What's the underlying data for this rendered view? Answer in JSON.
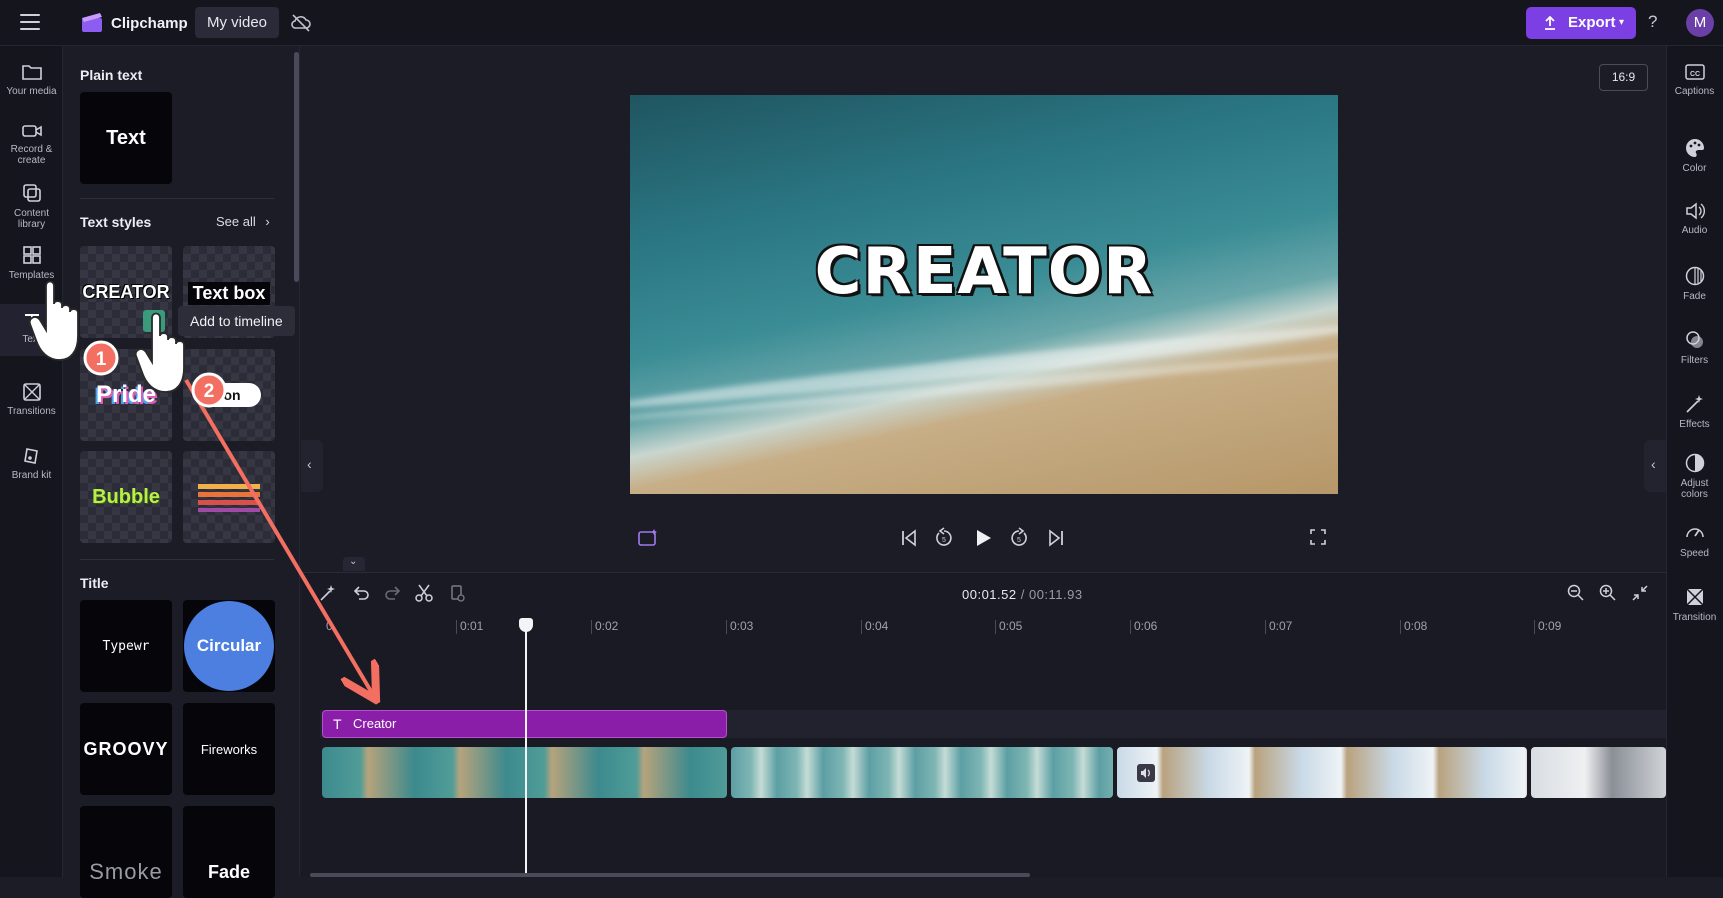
{
  "app": {
    "name": "Clipchamp",
    "project_name": "My video",
    "export_label": "Export",
    "help_label": "?",
    "avatar_initial": "M",
    "accent": "#7b3fe4"
  },
  "left_rail": [
    {
      "label": "Your media",
      "icon": "folder-icon"
    },
    {
      "label": "Record &\ncreate",
      "icon": "camera-icon"
    },
    {
      "label": "Content\nlibrary",
      "icon": "library-icon"
    },
    {
      "label": "Templates",
      "icon": "templates-icon"
    },
    {
      "label": "Text",
      "icon": "text-icon"
    },
    {
      "label": "Transitions",
      "icon": "transitions-icon"
    },
    {
      "label": "Brand kit",
      "icon": "brand-kit-icon"
    }
  ],
  "panel": {
    "plain_text_title": "Plain text",
    "plain_text_tile": "Text",
    "text_styles_title": "Text styles",
    "see_all": "See all",
    "text_styles": [
      "CREATOR",
      "Text box",
      "Pride",
      "on",
      "Bubble"
    ],
    "tooltip": "Add to timeline",
    "title_section": "Title",
    "titles": [
      "Typewr",
      "Circular",
      "GROOVY",
      "Fireworks",
      "Smoke",
      "Fade"
    ]
  },
  "preview": {
    "aspect_ratio": "16:9",
    "overlay_text": "CREATOR"
  },
  "timeline": {
    "current_time": "00:01.52",
    "total_time": "/ 00:11.93",
    "ruler": [
      "0",
      "0:01",
      "0:02",
      "0:03",
      "0:04",
      "0:05",
      "0:06",
      "0:07",
      "0:08",
      "0:09"
    ],
    "text_clip_label": "Creator"
  },
  "right_rail": [
    {
      "label": "Captions",
      "icon": "captions-icon"
    },
    {
      "label": "Color",
      "icon": "palette-icon"
    },
    {
      "label": "Audio",
      "icon": "speaker-icon"
    },
    {
      "label": "Fade",
      "icon": "fade-icon"
    },
    {
      "label": "Filters",
      "icon": "filters-icon"
    },
    {
      "label": "Effects",
      "icon": "magic-wand-icon"
    },
    {
      "label": "Adjust\ncolors",
      "icon": "adjust-colors-icon"
    },
    {
      "label": "Speed",
      "icon": "speed-icon"
    },
    {
      "label": "Transition",
      "icon": "transition-icon"
    }
  ],
  "annotations": {
    "step1": "1",
    "step2": "2",
    "arrow_color": "#f26f61"
  }
}
